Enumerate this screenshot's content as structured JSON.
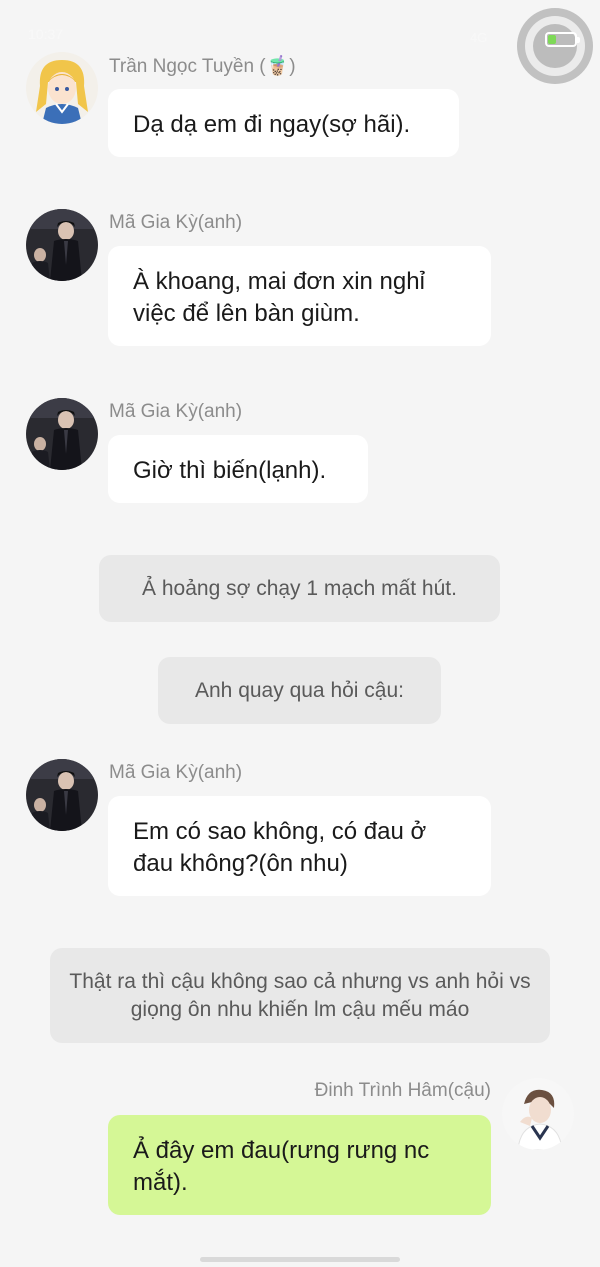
{
  "status_bar": {
    "time": "10:37",
    "right_text": "4G"
  },
  "messages": [
    {
      "sender": "Trần Ngọc Tuyền (🧋)",
      "text": "Dạ dạ em đi ngay(sợ hãi)."
    },
    {
      "sender": "Mã Gia Kỳ(anh)",
      "text": "À khoang, mai đơn xin nghỉ việc để lên bàn giùm."
    },
    {
      "sender": "Mã Gia Kỳ(anh)",
      "text": "Giờ thì biến(lạnh)."
    },
    {
      "narration": "Ả hoảng sợ chạy 1 mạch mất hút."
    },
    {
      "narration": "Anh quay qua hỏi cậu:"
    },
    {
      "sender": "Mã Gia Kỳ(anh)",
      "text": "Em có sao không, có đau ở đau không?(ôn nhu)"
    },
    {
      "narration": "Thật ra thì cậu không sao cả nhưng vs anh hỏi vs giọng ôn nhu khiến lm cậu mếu máo"
    },
    {
      "sender": "Đinh Trình Hâm(cậu)",
      "text": "Ả đây em đau(rưng rưng nc mắt).",
      "outgoing": true
    }
  ],
  "colors": {
    "background": "#f5f5f5",
    "bubble_incoming": "#ffffff",
    "bubble_outgoing": "#d5f796",
    "narration_bg": "#e8e8e8",
    "sender_name": "#8c8c8c"
  },
  "icons": [
    "floating-assistive-ball-icon",
    "battery-icon"
  ]
}
